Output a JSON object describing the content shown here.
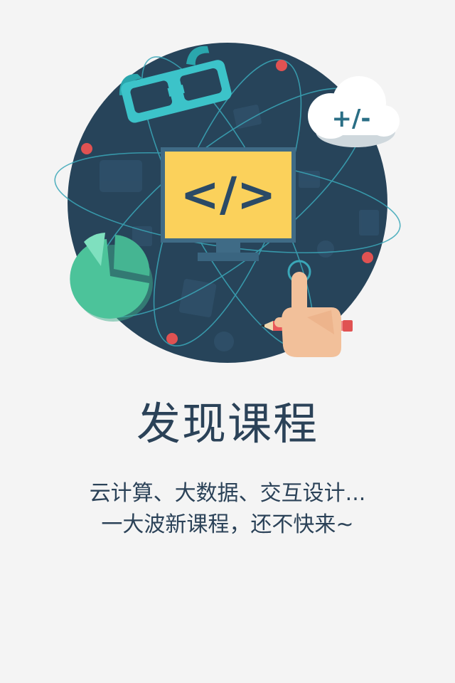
{
  "onboarding": {
    "title": "发现课程",
    "subtitle_line1": "云计算、大数据、交互设计...",
    "subtitle_line2": "一大波新课程，还不快来~",
    "illustration": {
      "monitor_code_symbol": "</>",
      "cloud_label": "+/-",
      "icons": [
        "3d-glasses-icon",
        "cloud-icon",
        "code-monitor-icon",
        "pie-chart-icon",
        "pointing-hand-icon",
        "pencil-icon"
      ]
    },
    "colors": {
      "background": "#f4f4f4",
      "circle": "#27445a",
      "text": "#2b4258",
      "monitor_screen": "#fbd15b",
      "glasses": "#3cc3c9",
      "pie": "#4cc39a",
      "accent_dot": "#e05252",
      "hand": "#f2c09a"
    }
  }
}
